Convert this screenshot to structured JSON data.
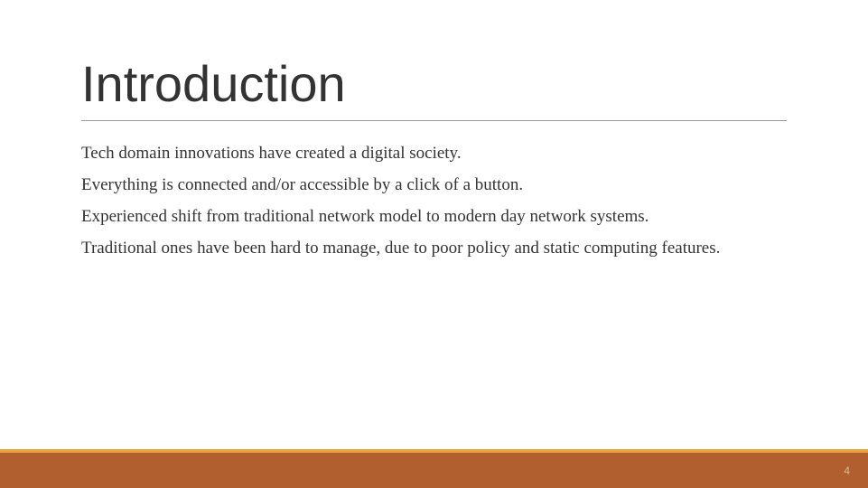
{
  "slide": {
    "title": "Introduction",
    "bullets": [
      "Tech domain innovations have created a digital society.",
      "Everything is connected and/or accessible by a click of a button.",
      "Experienced shift from traditional network model to modern day network systems.",
      "Traditional ones have been hard to manage, due to poor policy and static computing features."
    ],
    "pageNumber": "4"
  },
  "colors": {
    "footerBg": "#b15f2e",
    "footerAccent": "#e8a33d"
  }
}
